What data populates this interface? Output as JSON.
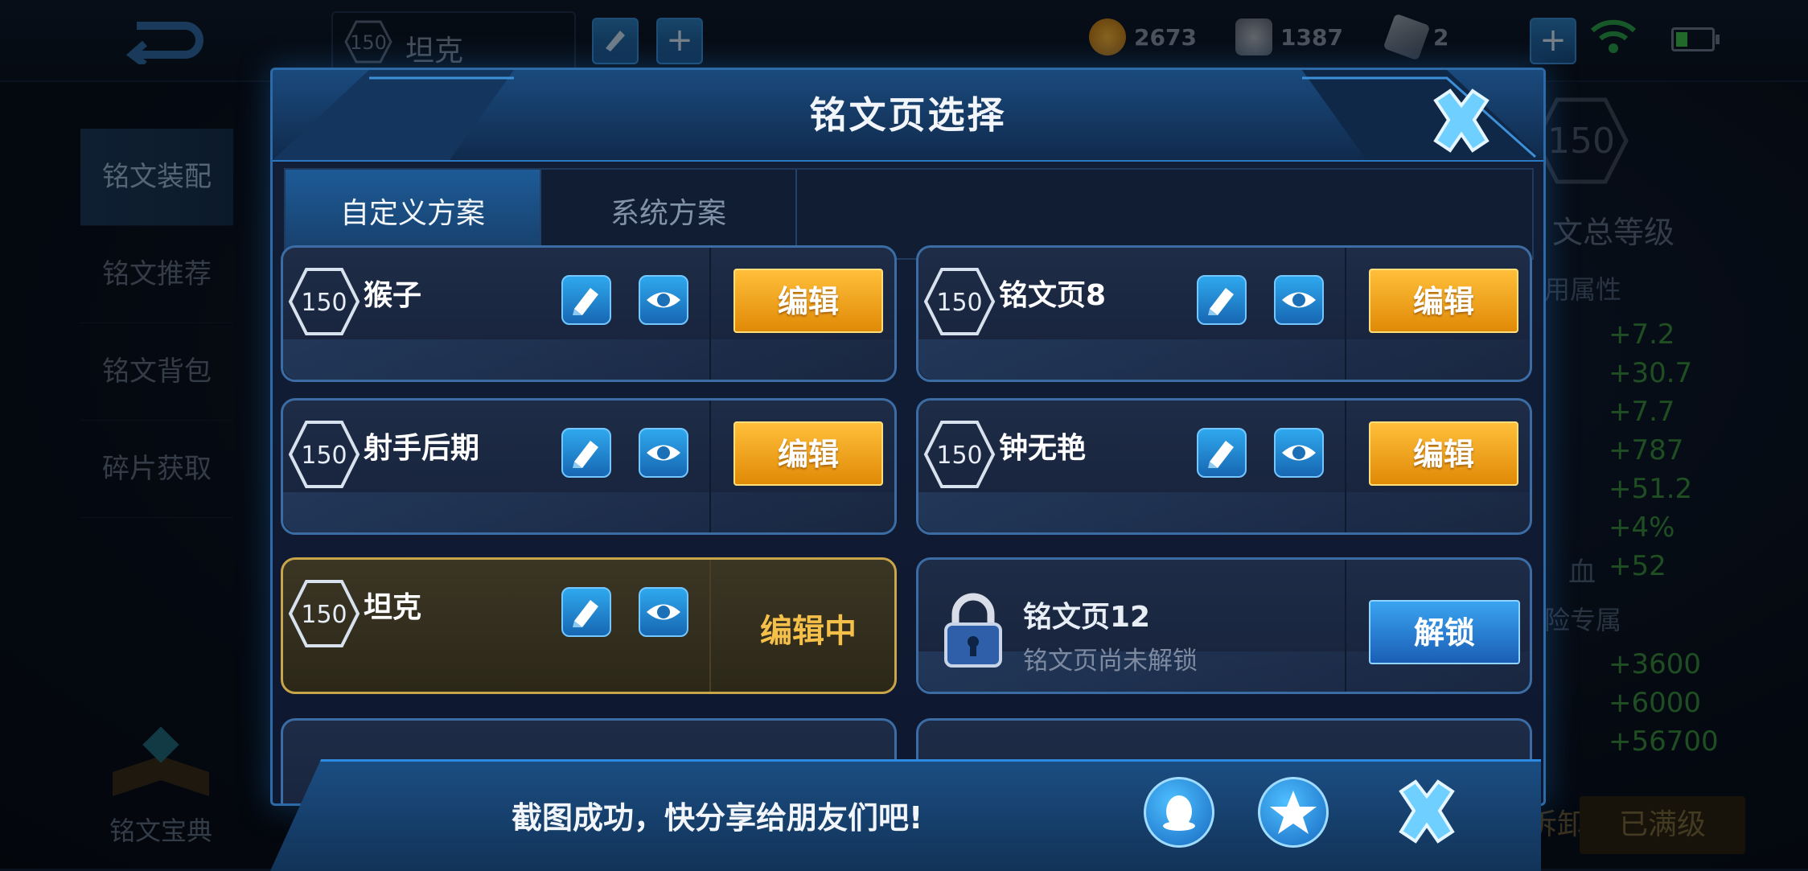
{
  "topbar": {
    "level": "150",
    "page_name": "坦克",
    "gold": "2673",
    "diamond": "1387",
    "fragment": "2"
  },
  "sidebar": {
    "items": [
      {
        "label": "铭文装配",
        "active": true
      },
      {
        "label": "铭文推荐",
        "active": false
      },
      {
        "label": "铭文背包",
        "active": false
      },
      {
        "label": "碎片获取",
        "active": false
      }
    ],
    "codex_label": "铭文宝典"
  },
  "stats": {
    "total_level": "150",
    "total_level_label": "文总等级",
    "attr_head": "用属性",
    "values": [
      "+7.2",
      "+30.7",
      "+7.7",
      "+787",
      "+51.2",
      "+4%",
      "+52"
    ],
    "last_attr_prefix": "血",
    "exp_head": "险专属",
    "exp_values": [
      "+3600",
      "+6000",
      "+56700"
    ],
    "unload_label": "拆卸",
    "full_label": "已满级"
  },
  "dialog": {
    "title": "铭文页选择",
    "tabs": [
      "自定义方案",
      "系统方案"
    ],
    "pages": [
      {
        "level": "150",
        "name": "猴子",
        "state": "edit"
      },
      {
        "level": "150",
        "name": "铭文页8",
        "state": "edit"
      },
      {
        "level": "150",
        "name": "射手后期",
        "state": "edit"
      },
      {
        "level": "150",
        "name": "钟无艳",
        "state": "edit"
      },
      {
        "level": "150",
        "name": "坦克",
        "state": "editing"
      },
      {
        "name": "铭文页12",
        "sub": "铭文页尚未解锁",
        "state": "locked"
      }
    ],
    "edit_label": "编辑",
    "editing_label": "编辑中",
    "unlock_label": "解锁"
  },
  "toast": {
    "message": "截图成功，快分享给朋友们吧!"
  },
  "colors": {
    "accent_blue": "#2c8ae0",
    "edit_orange": "#f0a019",
    "selected_gold": "#c9a54a",
    "stat_green": "#3a8f3e"
  }
}
